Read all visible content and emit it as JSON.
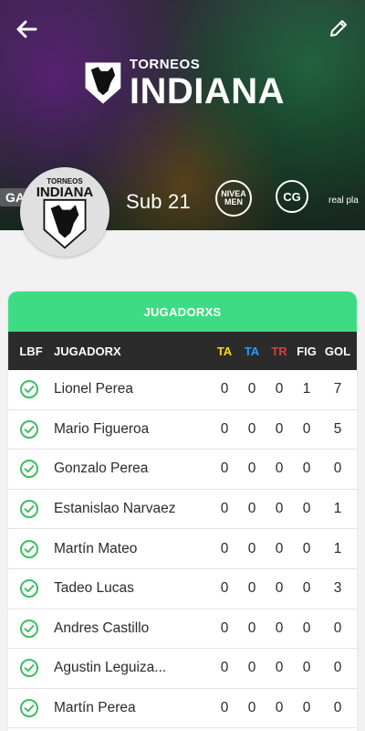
{
  "header": {
    "brand_small": "TORNEOS",
    "brand_big": "INDIANA",
    "category": "Sub 21",
    "sponsors": {
      "left": "GALE",
      "nivea_top": "NIVEA",
      "nivea_bottom": "MEN",
      "cg": "CG",
      "realpla": "real pla"
    },
    "avatar_small": "TORNEOS",
    "avatar_big": "INDIANA"
  },
  "card": {
    "title": "JUGADORXS",
    "columns": {
      "lbf": "LBF",
      "player": "JUGADORX",
      "ta1": "TA",
      "ta2": "TA",
      "tr": "TR",
      "fig": "FIG",
      "gol": "GOL"
    },
    "colors": {
      "accent": "#3ddc84",
      "check": "#3dbd63"
    },
    "rows": [
      {
        "name": "Lionel Perea",
        "ta1": "0",
        "ta2": "0",
        "tr": "0",
        "fig": "1",
        "gol": "7"
      },
      {
        "name": "Mario Figueroa",
        "ta1": "0",
        "ta2": "0",
        "tr": "0",
        "fig": "0",
        "gol": "5"
      },
      {
        "name": "Gonzalo Perea",
        "ta1": "0",
        "ta2": "0",
        "tr": "0",
        "fig": "0",
        "gol": "0"
      },
      {
        "name": "Estanislao Narvaez",
        "ta1": "0",
        "ta2": "0",
        "tr": "0",
        "fig": "0",
        "gol": "1"
      },
      {
        "name": "Martín Mateo",
        "ta1": "0",
        "ta2": "0",
        "tr": "0",
        "fig": "0",
        "gol": "1"
      },
      {
        "name": "Tadeo Lucas",
        "ta1": "0",
        "ta2": "0",
        "tr": "0",
        "fig": "0",
        "gol": "3"
      },
      {
        "name": "Andres Castillo",
        "ta1": "0",
        "ta2": "0",
        "tr": "0",
        "fig": "0",
        "gol": "0"
      },
      {
        "name": "Agustin Leguiza...",
        "ta1": "0",
        "ta2": "0",
        "tr": "0",
        "fig": "0",
        "gol": "0"
      },
      {
        "name": "Martín Perea",
        "ta1": "0",
        "ta2": "0",
        "tr": "0",
        "fig": "0",
        "gol": "0"
      }
    ]
  }
}
